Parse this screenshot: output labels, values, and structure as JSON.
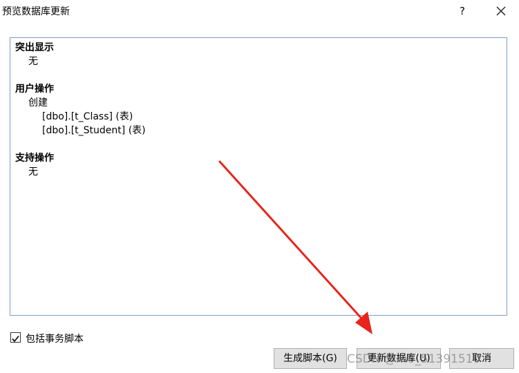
{
  "window": {
    "title": "预览数据库更新",
    "help_label": "?"
  },
  "preview": {
    "sections": [
      {
        "title": "突出显示",
        "items": [
          "无"
        ]
      },
      {
        "title": "用户操作",
        "action": "创建",
        "items": [
          "[dbo].[t_Class] (表)",
          "[dbo].[t_Student] (表)"
        ]
      },
      {
        "title": "支持操作",
        "items": [
          "无"
        ]
      }
    ]
  },
  "options": {
    "include_transaction_label": "包括事务脚本",
    "include_transaction_checked": true
  },
  "buttons": {
    "generate_script": "生成脚本(G)",
    "update_database": "更新数据库(U)",
    "cancel": "取消"
  },
  "watermark": "CSDN @m0_51391510",
  "annotation": {
    "arrow_color": "#e8241c"
  }
}
